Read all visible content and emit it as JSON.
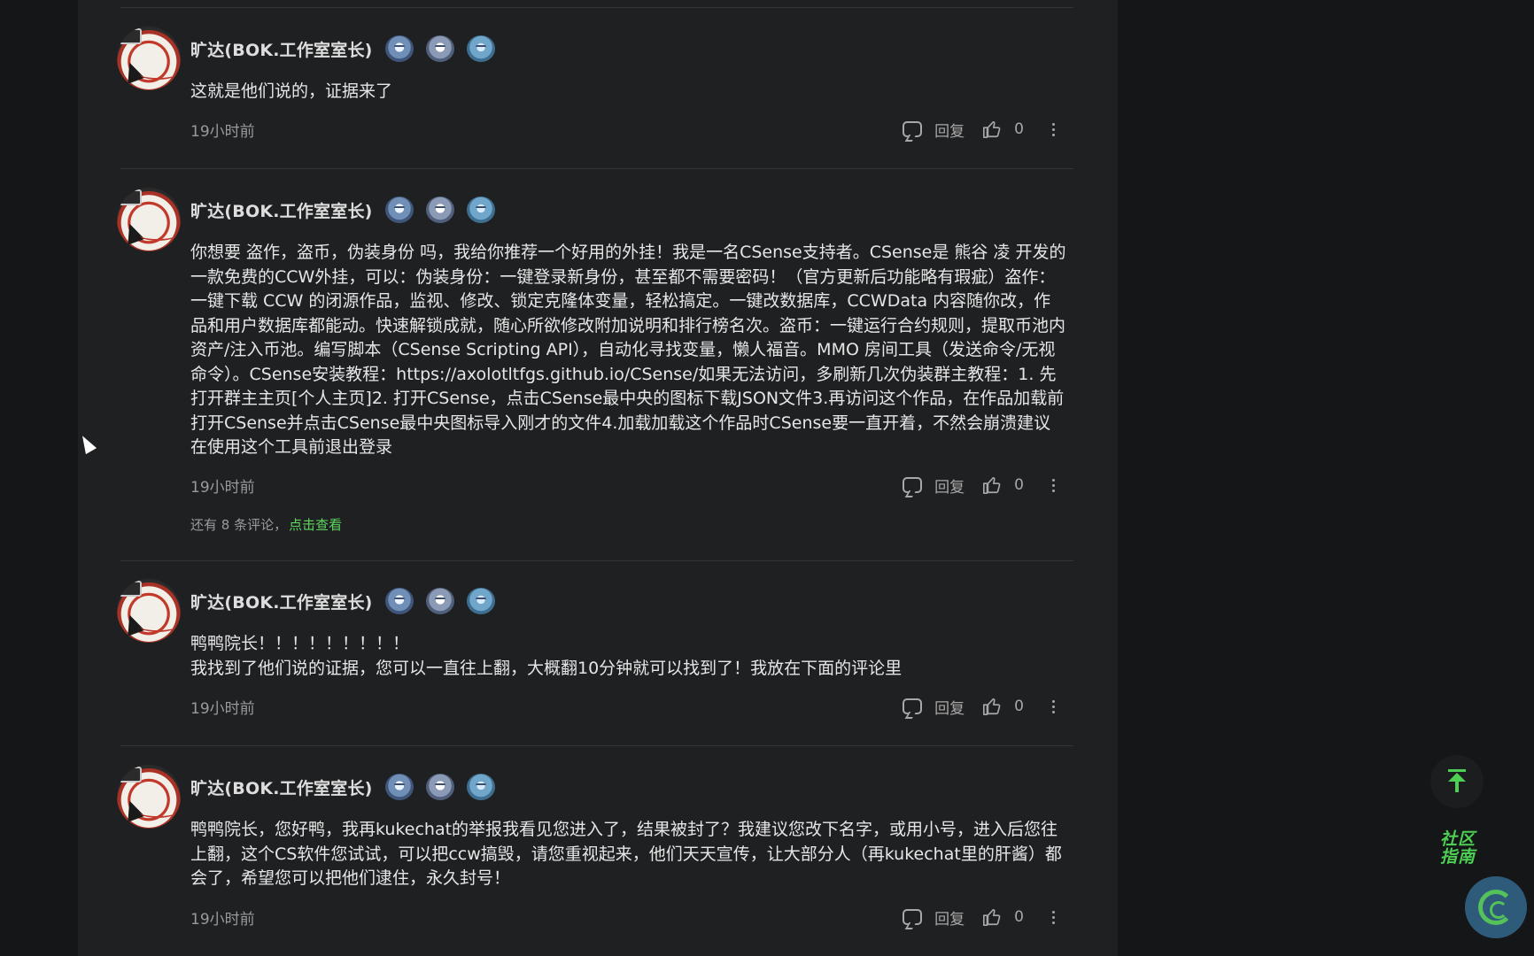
{
  "comments": [
    {
      "username": "旷达(BOK.工作室室长)",
      "text": "这就是他们说的，证据来了",
      "time": "19小时前",
      "reply_label": "回复",
      "likes": "0"
    },
    {
      "username": "旷达(BOK.工作室室长)",
      "text": "你想要 盗作，盗币，伪装身份 吗，我给你推荐一个好用的外挂！我是一名CSense支持者。CSense是 熊谷 凌 开发的一款免费的CCW外挂，可以：伪装身份：一键登录新身份，甚至都不需要密码！（官方更新后功能略有瑕疵）盗作：一键下载 CCW 的闭源作品，监视、修改、锁定克隆体变量，轻松搞定。一键改数据库，CCWData 内容随你改，作品和用户数据库都能动。快速解锁成就，随心所欲修改附加说明和排行榜名次。盗币：一键运行合约规则，提取币池内资产/注入币池。编写脚本（CSense Scripting API），自动化寻找变量，懒人福音。MMO 房间工具（发送命令/无视命令）。CSense安装教程：https://axolotltfgs.github.io/CSense/如果无法访问，多刷新几次伪装群主教程：1. 先打开群主主页[个人主页]2. 打开CSense，点击CSense最中央的图标下载JSON文件3.再访问这个作品，在作品加载前打开CSense并点击CSense最中央图标导入刚才的文件4.加载加载这个作品时CSense要一直开着，不然会崩溃建议在使用这个工具前退出登录",
      "time": "19小时前",
      "reply_label": "回复",
      "likes": "0",
      "more_replies_text": "还有 8 条评论，",
      "more_replies_link": "点击查看"
    },
    {
      "username": "旷达(BOK.工作室室长)",
      "text": "鸭鸭院长！！！！！！！！！\n我找到了他们说的证据，您可以一直往上翻，大概翻10分钟就可以找到了！我放在下面的评论里",
      "time": "19小时前",
      "reply_label": "回复",
      "likes": "0"
    },
    {
      "username": "旷达(BOK.工作室室长)",
      "text": "鸭鸭院长，您好鸭，我再kukechat的举报我看见您进入了，结果被封了？我建议您改下名字，或用小号，进入后您往上翻，这个CS软件您试试，可以把ccw搞毁，请您重视起来，他们天天宣传，让大部分人（再kukechat里的肝酱）都会了，希望您可以把他们逮住，永久封号！",
      "time": "19小时前",
      "reply_label": "回复",
      "likes": "0"
    }
  ],
  "floating": {
    "guide_label": "社区指南",
    "back_to_top_icon": "arrow-up-to-top-icon",
    "logo_icon": "ccw-logo-icon"
  },
  "colors": {
    "accent_green": "#4ccf52",
    "panel_bg": "#1f2022",
    "page_bg": "#151617"
  }
}
